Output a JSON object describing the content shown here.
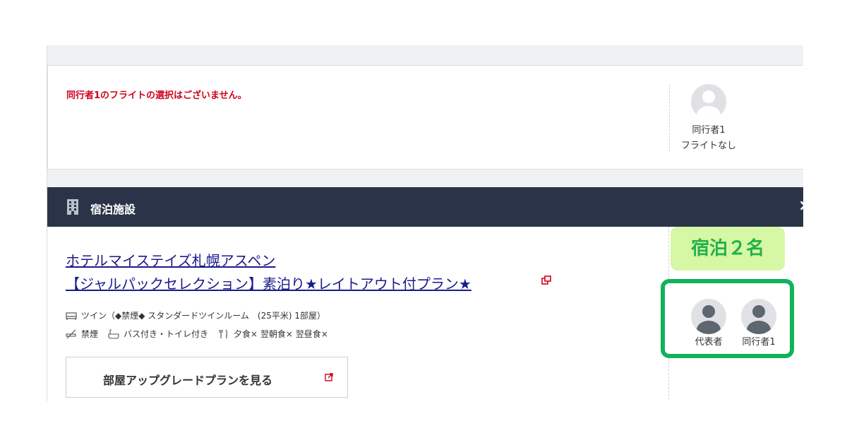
{
  "flight": {
    "notice": "同行者1のフライトの選択はございません。",
    "companion": {
      "name": "同行者1",
      "status": "フライトなし"
    }
  },
  "hotel": {
    "section_title": "宿泊施設",
    "collapse_glyph": "×",
    "name": "ホテルマイステイズ札幌アスペン",
    "plan": "【ジャルパックセレクション】素泊り★レイトアウト付プラン★",
    "room": "ツイン（◆禁煙◆ スタンダードツインルーム　(25平米) 1部屋）",
    "amenities": {
      "smoking": "禁煙",
      "bath": "バス付き・トイレ付き",
      "meals": "夕食× 翌朝食× 翌昼食×"
    },
    "upgrade_button": "部屋アップグレードプランを見る"
  },
  "guests": {
    "count_label": "宿泊２名",
    "list": [
      {
        "label": "代表者"
      },
      {
        "label": "同行者1"
      }
    ]
  },
  "icons": [
    "building-icon",
    "collapse-icon",
    "external-link-icon",
    "bed-icon",
    "no-smoking-icon",
    "bath-icon",
    "meal-icon",
    "avatar-icon"
  ],
  "colors": {
    "notice_red": "#d0021b",
    "header_navy": "#2b3348",
    "link_blue": "#1a1b8a",
    "guest_green": "#11b25b",
    "guest_highlight": "#d6f7a4"
  }
}
